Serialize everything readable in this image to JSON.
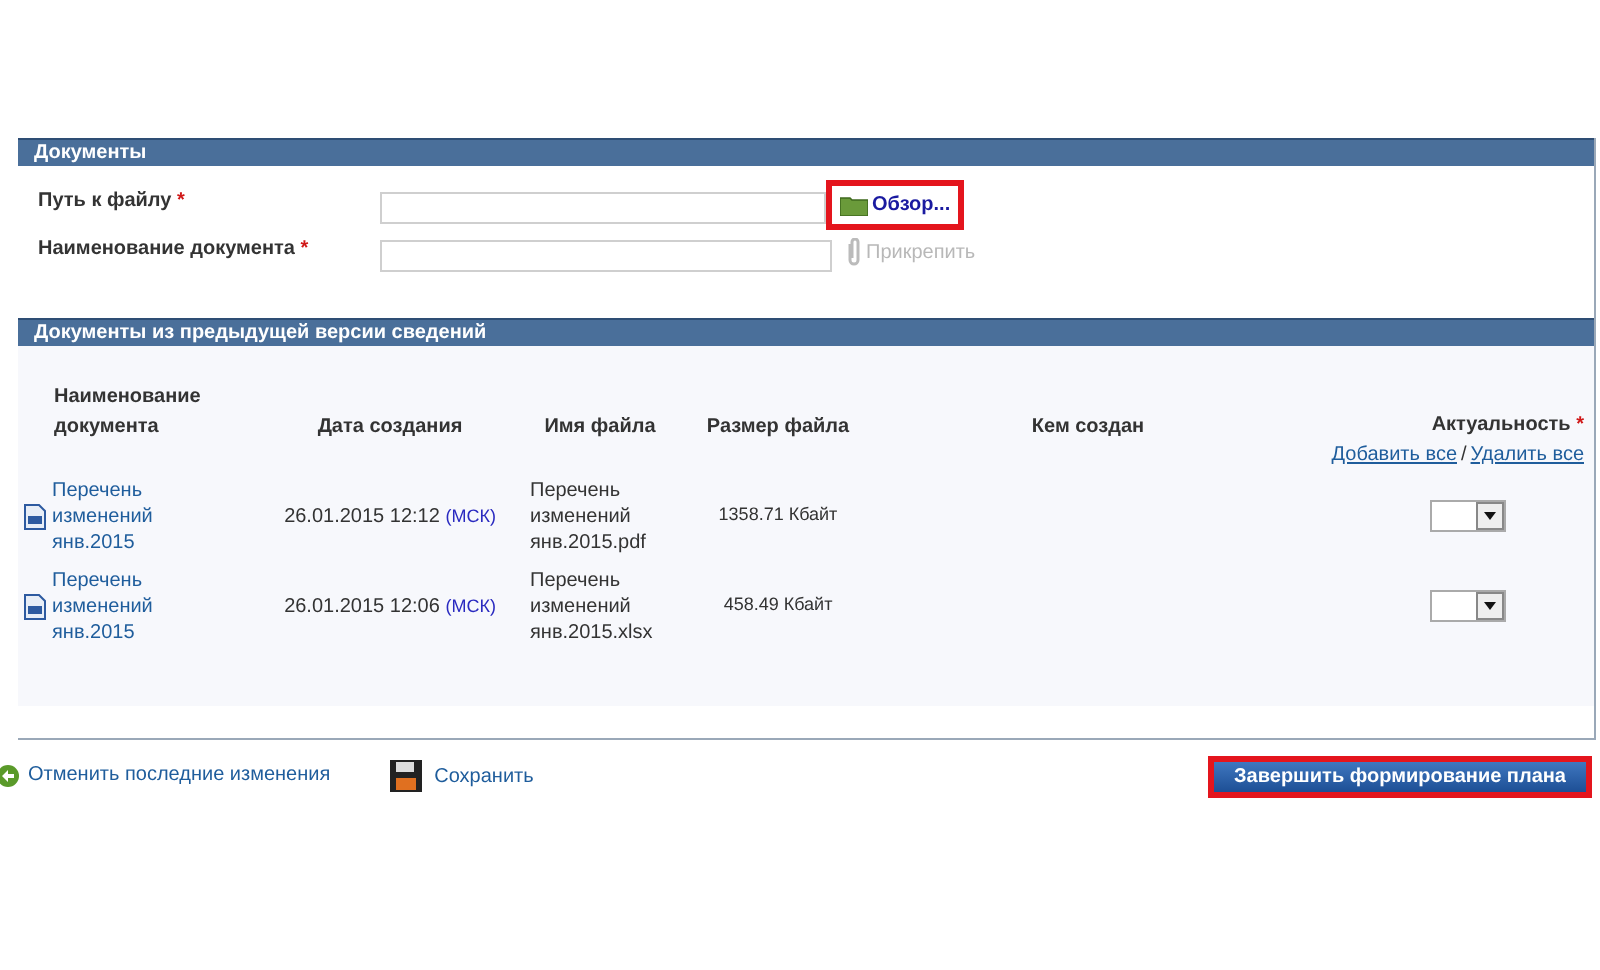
{
  "documents_section": {
    "title": "Документы",
    "fields": [
      {
        "label": "Путь к файлу",
        "required_mark": "*",
        "action": {
          "kind": "browse",
          "label": "Обзор...",
          "disabled": false,
          "highlighted": true
        }
      },
      {
        "label": "Наименование документа",
        "required_mark": "*",
        "action": {
          "kind": "attach",
          "label": "Прикрепить",
          "disabled": true,
          "highlighted": false
        }
      }
    ]
  },
  "previous_section": {
    "title": "Документы из предыдущей версии сведений",
    "table": {
      "columns": [
        "Наименование документа",
        "Дата создания",
        "Имя файла",
        "Размер файла",
        "Кем создан",
        "Актуальность"
      ],
      "required_mark": "*",
      "add_all": "Добавить все",
      "separator": "/",
      "remove_all": "Удалить все",
      "rows": [
        {
          "name": "Перечень изменений янв.2015",
          "date": "26.01.2015 12:12",
          "timezone": "(МСК)",
          "file": "Перечень изменений янв.2015.pdf",
          "size": "1358.71 Кбайт"
        },
        {
          "name": "Перечень изменений янв.2015",
          "date": "26.01.2015 12:06",
          "timezone": "(МСК)",
          "file": "Перечень изменений янв.2015.xlsx",
          "size": "458.49 Кбайт"
        }
      ]
    }
  },
  "footer": {
    "undo": "Отменить последние изменения",
    "save": "Сохранить",
    "finish": {
      "label": "Завершить формирование плана",
      "highlighted": true
    }
  }
}
